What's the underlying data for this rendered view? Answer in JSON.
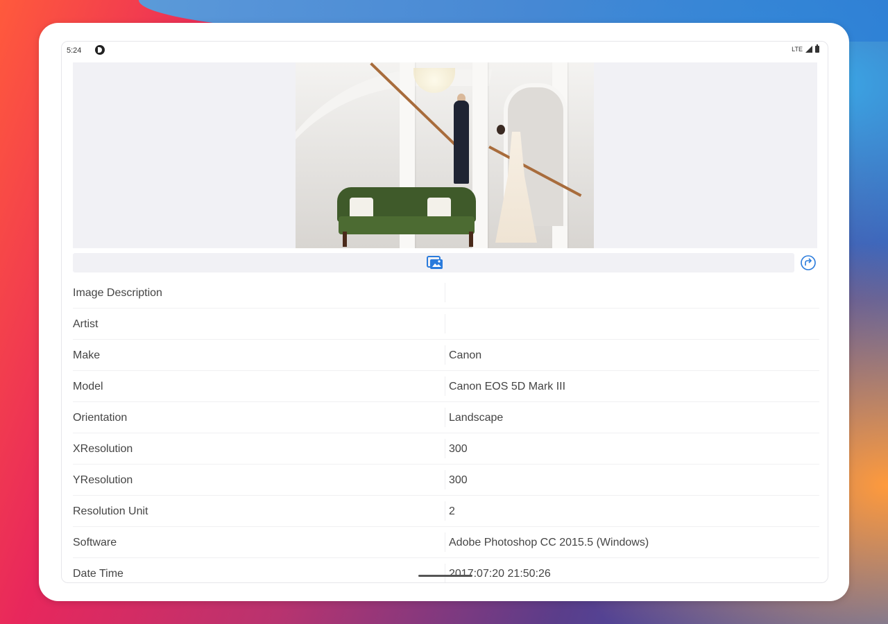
{
  "status_bar": {
    "time": "5:24",
    "network": "LTE",
    "app_icon": "app-status-icon",
    "signal_icon": "signal-icon",
    "battery_icon": "battery-icon"
  },
  "toolbar": {
    "edit_icon": "image-edit-icon",
    "share_icon": "share-icon",
    "accent_color": "#2a7bdc"
  },
  "exif": {
    "rows": [
      {
        "label": "Image Description",
        "value": ""
      },
      {
        "label": "Artist",
        "value": ""
      },
      {
        "label": "Make",
        "value": "Canon"
      },
      {
        "label": "Model",
        "value": "Canon EOS 5D Mark III"
      },
      {
        "label": "Orientation",
        "value": "Landscape"
      },
      {
        "label": "XResolution",
        "value": "300"
      },
      {
        "label": "YResolution",
        "value": "300"
      },
      {
        "label": "Resolution Unit",
        "value": "2"
      },
      {
        "label": "Software",
        "value": "Adobe Photoshop CC 2015.5 (Windows)"
      },
      {
        "label": "Date Time",
        "value": "2017:07:20 21:50:26"
      }
    ]
  }
}
